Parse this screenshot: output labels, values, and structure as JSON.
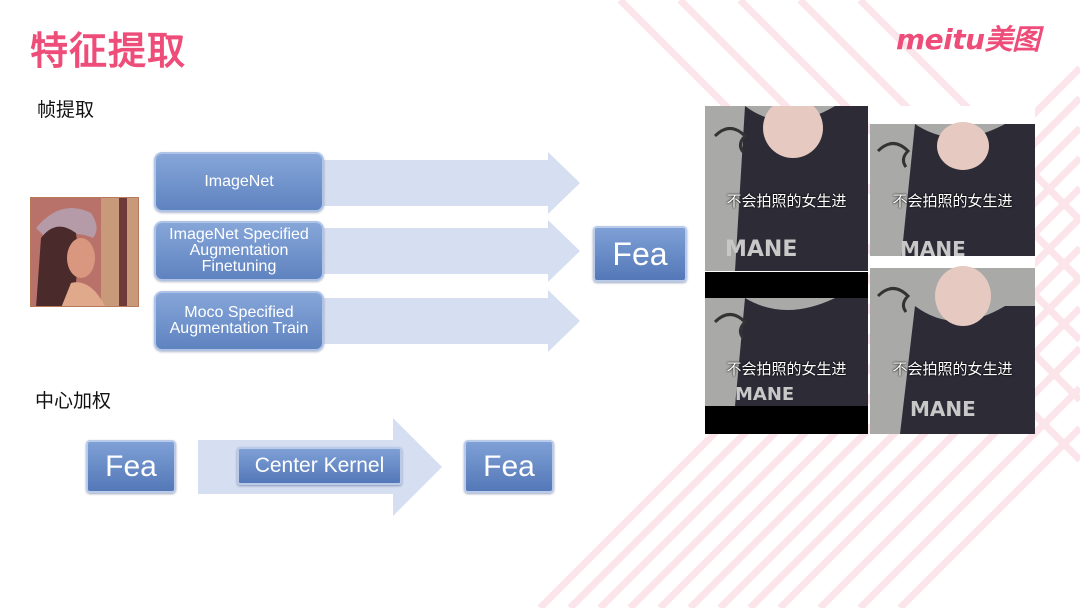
{
  "title": "特征提取",
  "brand": "meitu美图",
  "sections": {
    "frame_extraction": "帧提取",
    "center_weighting": "中心加权"
  },
  "pipeline": {
    "branches": [
      "ImageNet",
      "ImageNet Specified\nAugmentation\nFinetuning",
      "Moco Specified\nAugmentation Train"
    ],
    "output": "Fea"
  },
  "weighting": {
    "input": "Fea",
    "kernel": "Center Kernel",
    "output": "Fea"
  },
  "frames": {
    "caption": "不会拍照的女生进",
    "shirt_text": "MANE"
  },
  "colors": {
    "accent": "#ee4d7a",
    "box": "#6f92cc",
    "arrow": "#d6def1"
  }
}
